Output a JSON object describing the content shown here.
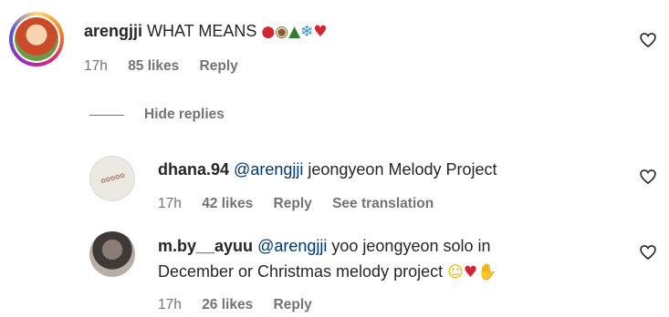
{
  "comments": [
    {
      "username": "arengjji",
      "text": "WHAT MEANS",
      "emojis": [
        "apple",
        "dog-face",
        "christmas-tree",
        "snowflake",
        "red-heart"
      ],
      "time": "17h",
      "likes": "85 likes",
      "reply": "Reply"
    }
  ],
  "hide_replies": "Hide replies",
  "replies": [
    {
      "username": "dhana.94",
      "mention": "@arengjji",
      "text": "jeongyeon Melody Project",
      "time": "17h",
      "likes": "42 likes",
      "reply": "Reply",
      "see_translation": "See translation"
    },
    {
      "username": "m.by__ayuu",
      "mention": "@arengjji",
      "text": "yoo jeongyeon solo in",
      "text_line2": "December or Christmas melody project",
      "emojis": [
        "star-struck",
        "red-heart",
        "raising-hands"
      ],
      "time": "17h",
      "likes": "26 likes",
      "reply": "Reply"
    }
  ],
  "icons": {
    "like": "heart-outline-icon"
  }
}
